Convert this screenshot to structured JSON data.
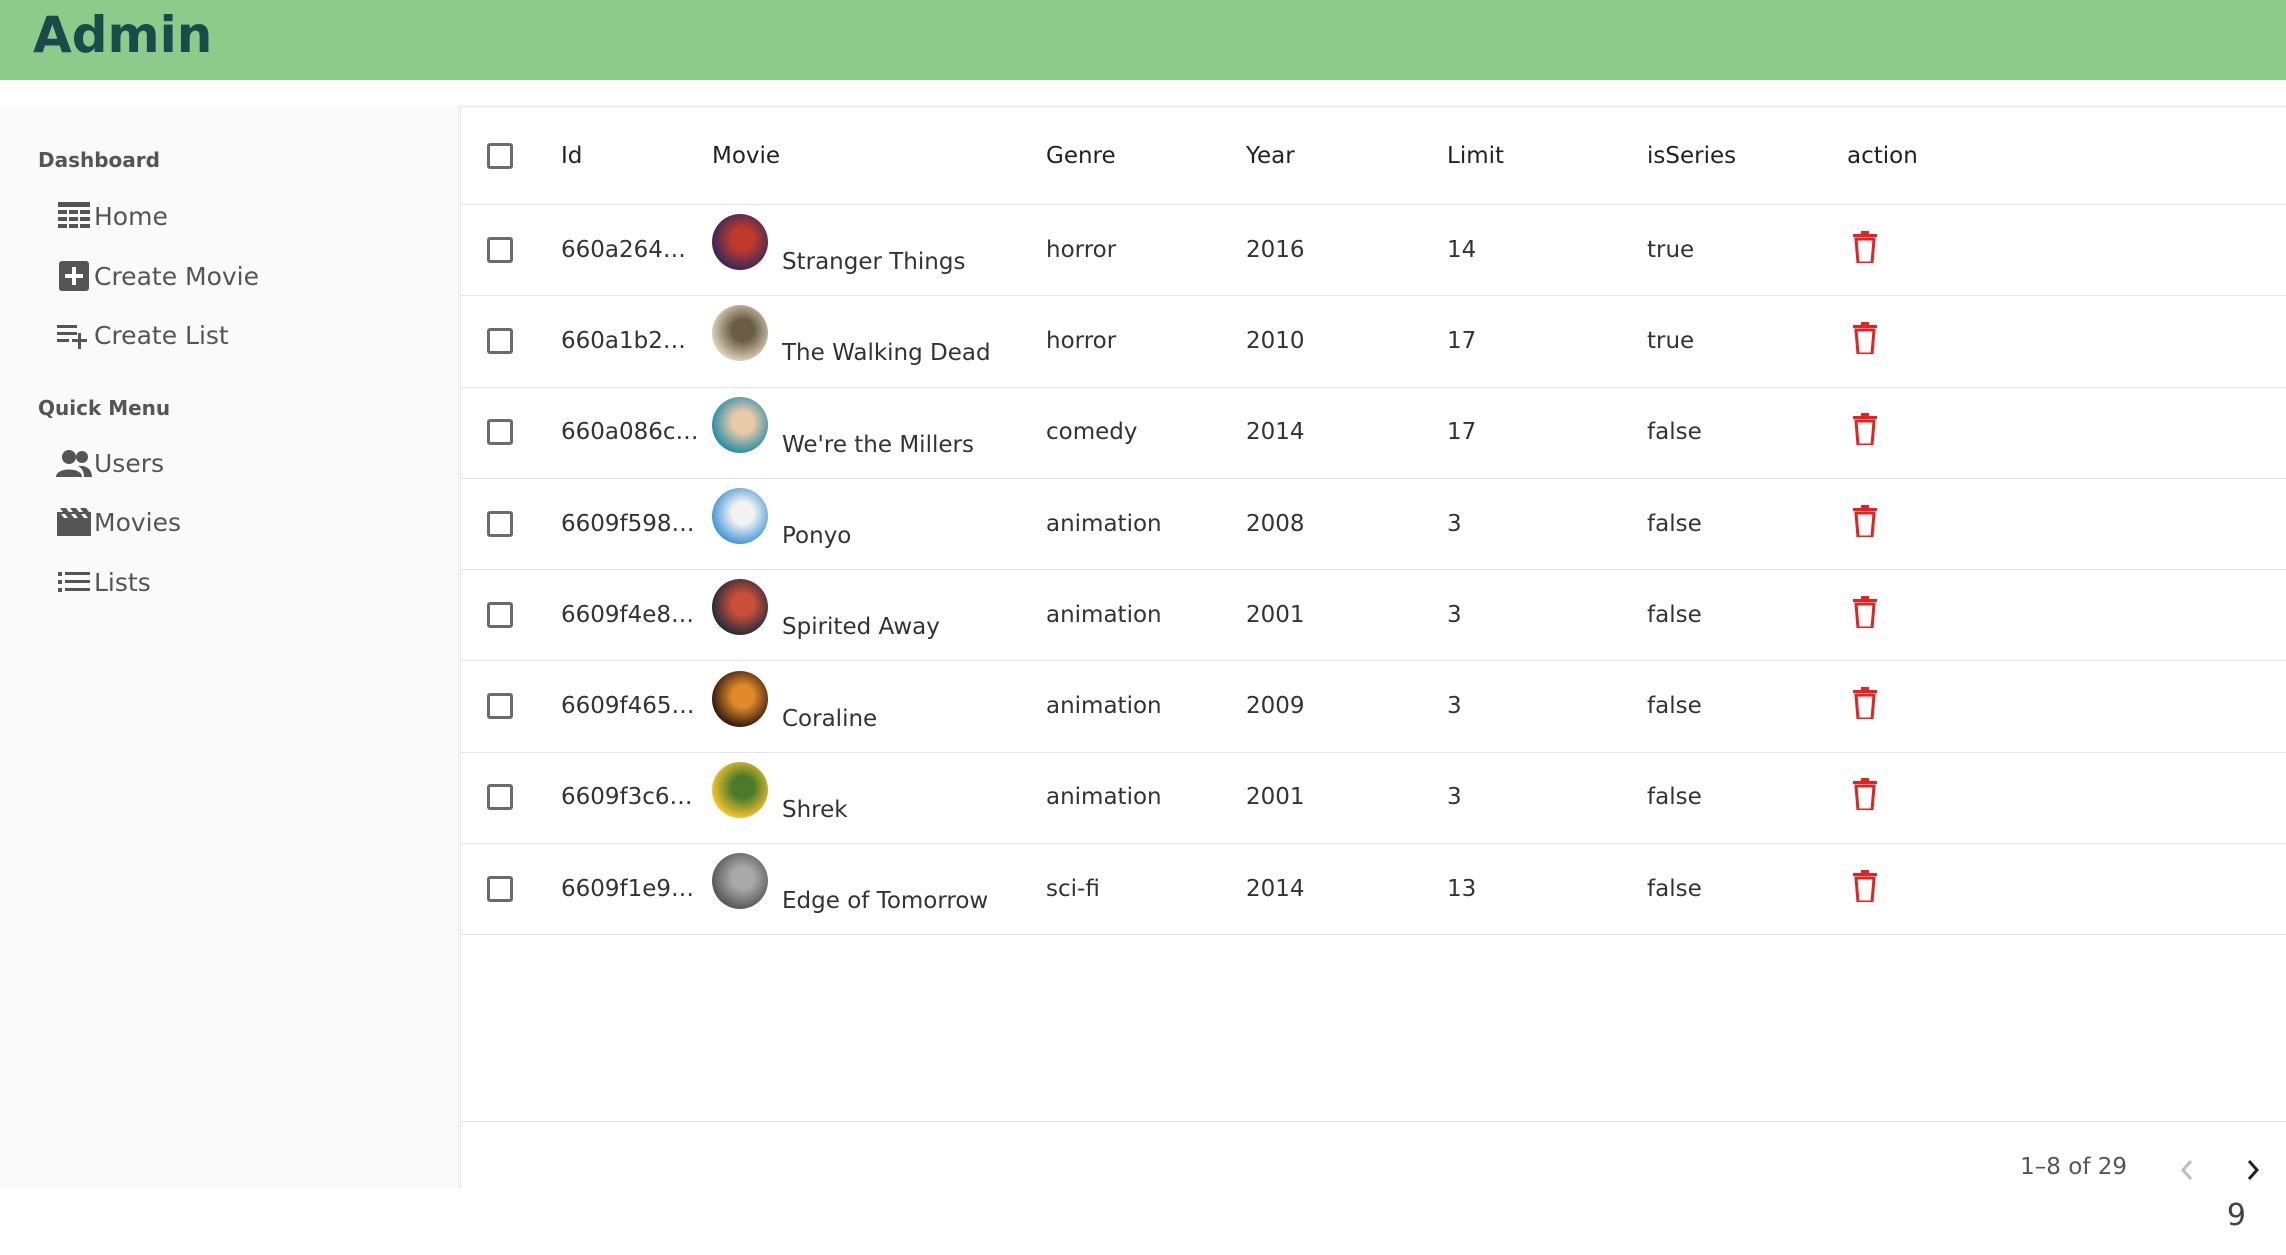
{
  "app": {
    "title": "Admin"
  },
  "sidebar": {
    "sections": [
      {
        "title": "Dashboard",
        "items": [
          {
            "label": "Home",
            "icon": "home-icon"
          },
          {
            "label": "Create Movie",
            "icon": "add-box-icon"
          },
          {
            "label": "Create List",
            "icon": "playlist-add-icon"
          }
        ]
      },
      {
        "title": "Quick Menu",
        "items": [
          {
            "label": "Users",
            "icon": "users-icon"
          },
          {
            "label": "Movies",
            "icon": "movie-icon"
          },
          {
            "label": "Lists",
            "icon": "list-icon"
          }
        ]
      }
    ]
  },
  "table": {
    "headers": [
      "Id",
      "Movie",
      "Genre",
      "Year",
      "Limit",
      "isSeries",
      "action"
    ],
    "rows": [
      {
        "id": "660a264…",
        "movie": "Stranger Things",
        "genre": "horror",
        "year": "2016",
        "limit": "14",
        "isSeries": "true",
        "avatar_colors": [
          "#3a2a5a",
          "#c0392b"
        ]
      },
      {
        "id": "660a1b2…",
        "movie": "The Walking Dead",
        "genre": "horror",
        "year": "2010",
        "limit": "17",
        "isSeries": "true",
        "avatar_colors": [
          "#d8cdb5",
          "#6b5c45"
        ]
      },
      {
        "id": "660a086c…",
        "movie": "We're the Millers",
        "genre": "comedy",
        "year": "2014",
        "limit": "17",
        "isSeries": "false",
        "avatar_colors": [
          "#2c8fa8",
          "#e8c9a8"
        ]
      },
      {
        "id": "6609f598…",
        "movie": "Ponyo",
        "genre": "animation",
        "year": "2008",
        "limit": "3",
        "isSeries": "false",
        "avatar_colors": [
          "#4a9ad8",
          "#f2f2f2"
        ]
      },
      {
        "id": "6609f4e8…",
        "movie": "Spirited Away",
        "genre": "animation",
        "year": "2001",
        "limit": "3",
        "isSeries": "false",
        "avatar_colors": [
          "#2c2c3a",
          "#c94f3a"
        ]
      },
      {
        "id": "6609f465…",
        "movie": "Coraline",
        "genre": "animation",
        "year": "2009",
        "limit": "3",
        "isSeries": "false",
        "avatar_colors": [
          "#3a1e12",
          "#e08a2a"
        ]
      },
      {
        "id": "6609f3c6…",
        "movie": "Shrek",
        "genre": "animation",
        "year": "2001",
        "limit": "3",
        "isSeries": "false",
        "avatar_colors": [
          "#f2c12e",
          "#4b7a2a"
        ]
      },
      {
        "id": "6609f1e9…",
        "movie": "Edge of Tomorrow",
        "genre": "sci-fi",
        "year": "2014",
        "limit": "13",
        "isSeries": "false",
        "avatar_colors": [
          "#5a5a5a",
          "#a9a9a9"
        ]
      }
    ]
  },
  "pagination": {
    "range": "1–8 of 29"
  },
  "page_number": "9",
  "colors": {
    "header": "#8ccb8a",
    "brand_text": "#1a4a4a",
    "delete": "#e52222"
  }
}
